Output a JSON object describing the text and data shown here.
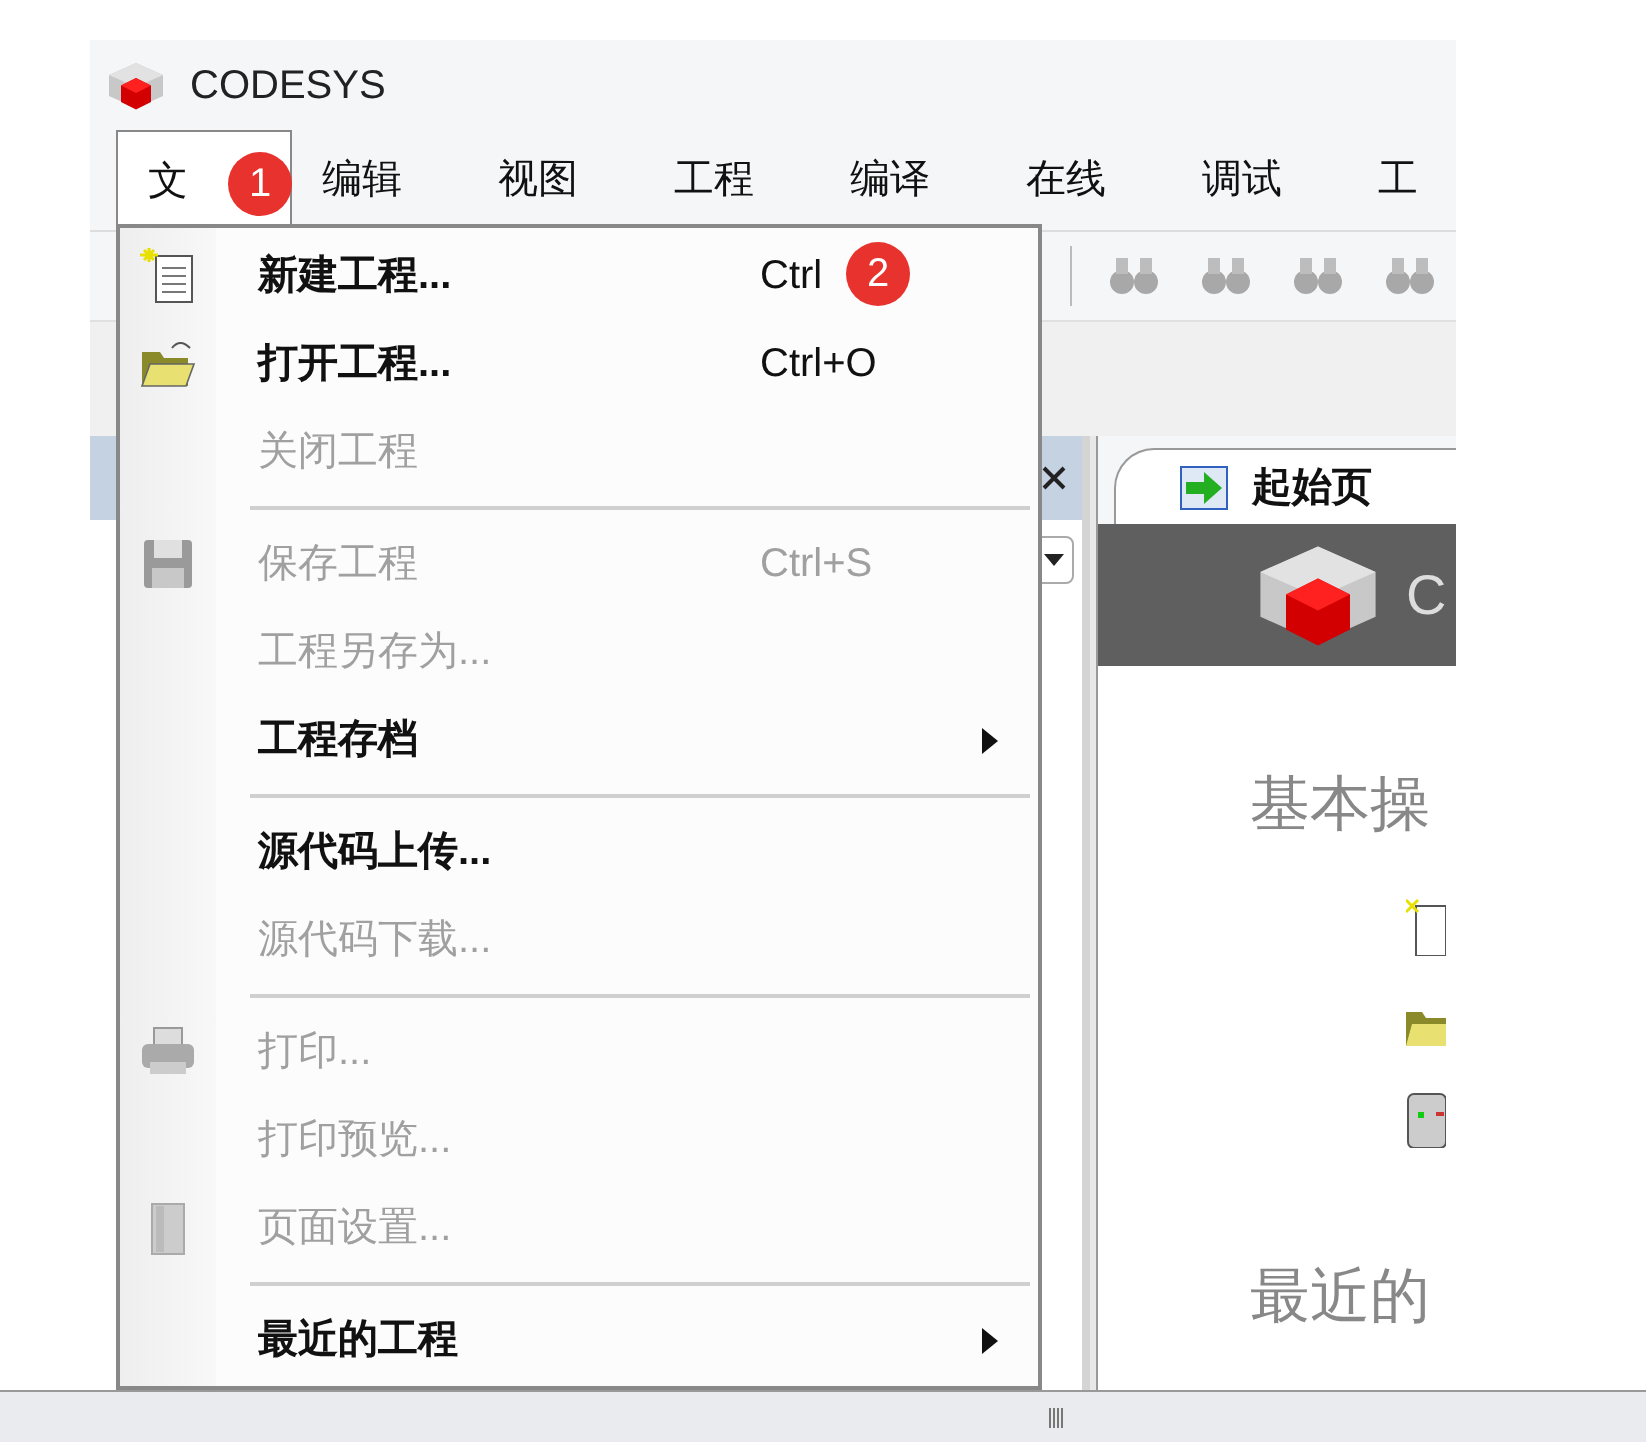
{
  "window": {
    "title": "CODESYS"
  },
  "menu_bar": [
    {
      "label": "文",
      "selected": true
    },
    {
      "label": "编辑",
      "selected": false
    },
    {
      "label": "视图",
      "selected": false
    },
    {
      "label": "工程",
      "selected": false
    },
    {
      "label": "编译",
      "selected": false
    },
    {
      "label": "在线",
      "selected": false
    },
    {
      "label": "调试",
      "selected": false
    },
    {
      "label": "工",
      "selected": false
    }
  ],
  "file_menu": [
    {
      "kind": "item",
      "label": "新建工程...",
      "shortcut": "Ctrl",
      "disabled": false
    },
    {
      "kind": "item",
      "label": "打开工程...",
      "shortcut": "Ctrl+O",
      "disabled": false
    },
    {
      "kind": "item",
      "label": "关闭工程",
      "disabled": true
    },
    {
      "kind": "separator"
    },
    {
      "kind": "item",
      "label": "保存工程",
      "shortcut": "Ctrl+S",
      "disabled": true
    },
    {
      "kind": "item",
      "label": "工程另存为...",
      "disabled": true
    },
    {
      "kind": "submenu",
      "label": "工程存档",
      "disabled": false
    },
    {
      "kind": "separator"
    },
    {
      "kind": "item",
      "label": "源代码上传...",
      "disabled": false
    },
    {
      "kind": "item",
      "label": "源代码下载...",
      "disabled": true
    },
    {
      "kind": "separator"
    },
    {
      "kind": "item",
      "label": "打印...",
      "disabled": true
    },
    {
      "kind": "item",
      "label": "打印预览...",
      "disabled": true
    },
    {
      "kind": "item",
      "label": "页面设置...",
      "disabled": true
    },
    {
      "kind": "separator"
    },
    {
      "kind": "submenu",
      "label": "最近的工程",
      "disabled": false
    }
  ],
  "badges": [
    "1",
    "2"
  ],
  "start_page": {
    "tab": {
      "label": "起始页",
      "selected": true
    },
    "banner_text": "C",
    "headings": [
      "基本操",
      "最近的"
    ]
  }
}
